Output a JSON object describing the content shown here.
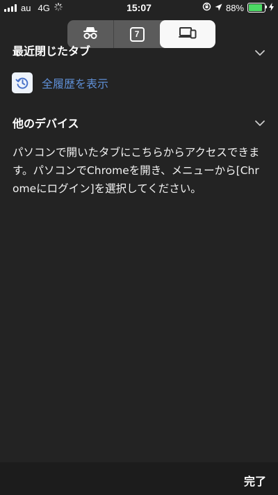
{
  "status_bar": {
    "carrier": "au",
    "network": "4G",
    "time": "15:07",
    "battery_percent": "88%",
    "battery_level": 0.88,
    "battery_color": "#4cd964"
  },
  "tab_switcher": {
    "segments": [
      {
        "icon": "incognito-icon"
      },
      {
        "icon": "tab-count-icon",
        "count": "7"
      },
      {
        "icon": "devices-icon",
        "selected": true
      }
    ]
  },
  "recent_tabs": {
    "header_label": "最近閉じたタブ",
    "full_history_label": "全履歴を表示",
    "history_icon": "history-icon",
    "link_color": "#5f8fd6"
  },
  "other_devices": {
    "title": "他のデバイス",
    "description": "パソコンで開いたタブにこちらからアクセスできます。パソコンでChromeを開き、メニューから[Chromeにログイン]を選択してください。"
  },
  "bottom_bar": {
    "done_label": "完了"
  }
}
